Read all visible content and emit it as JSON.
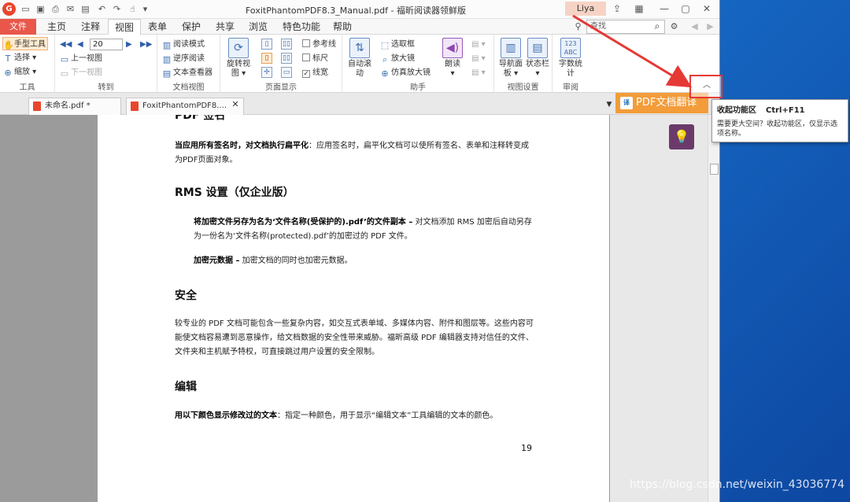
{
  "window": {
    "title": "FoxitPhantomPDF8.3_Manual.pdf - 福昕阅读器领鲜版",
    "user": "Liya"
  },
  "menu": {
    "file": "文件",
    "tabs": [
      "主页",
      "注释",
      "视图",
      "表单",
      "保护",
      "共享",
      "浏览",
      "特色功能",
      "帮助"
    ],
    "active": "视图",
    "search_placeholder": "查找"
  },
  "ribbon": {
    "tools": {
      "hand": "手型工具",
      "select": "选择",
      "zoom": "缩放",
      "label": "工具"
    },
    "goto": {
      "page_value": "20",
      "prev_view": "上一视图",
      "next_view": "下一视图",
      "label": "转到"
    },
    "doc_view": {
      "read_mode": "阅读模式",
      "reverse_read": "逆序阅读",
      "text_viewer": "文本查看器",
      "label": "文档视图"
    },
    "page_display": {
      "rotate": "旋转视图",
      "guides": "参考线",
      "ruler": "标尺",
      "linewidth": "线宽",
      "label": "页面显示"
    },
    "assistant": {
      "auto_scroll": "自动滚动",
      "marquee": "选取框",
      "loupe": "放大镜",
      "magnifier": "仿真放大镜",
      "read_aloud": "朗读",
      "label": "助手"
    },
    "view_settings": {
      "nav_panel": "导航面板",
      "status_bar": "状态栏",
      "label": "视图设置"
    },
    "review": {
      "word_count": "字数统计",
      "word_count_icon": "123 ABC",
      "label": "审阅"
    }
  },
  "tabs": [
    {
      "label": "未命名.pdf *"
    },
    {
      "label": "FoxitPhantomPDF8...."
    }
  ],
  "translate_button": "PDF文档翻译",
  "tooltip": {
    "title": "收起功能区",
    "shortcut": "Ctrl+F11",
    "desc": "需要更大空间？收起功能区，仅显示选项名称。"
  },
  "document": {
    "h_sign": "PDF 签名",
    "p_sign_bold": "当应用所有签名时，对文档执行扁平化",
    "p_sign_rest": "：应用签名时，扁平化文档可以使所有签名、表单和注释转变成为PDF页面对象。",
    "h_rms": "RMS 设置（仅企业版）",
    "p_rms1_bold": "将加密文件另存为名为‘文件名称(受保护的).pdf’的文件副本 –",
    "p_rms1_rest": " 对文档添加 RMS 加密后自动另存为一份名为‘文件名称(protected).pdf’的加密过的 PDF 文件。",
    "p_rms2_bold": "加密元数据 –",
    "p_rms2_rest": " 加密文档的同时也加密元数据。",
    "h_security": "安全",
    "p_security": "较专业的 PDF 文档可能包含一些复杂内容，如交互式表单域、多媒体内容、附件和图层等。这些内容可能使文档容易遭到恶意操作，给文档数据的安全性带来威胁。福昕高级 PDF 编辑器支持对信任的文件、文件夹和主机赋予特权，可直接跳过用户设置的安全限制。",
    "h_edit": "编辑",
    "p_edit_bold": "用以下颜色显示修改过的文本",
    "p_edit_rest": "：指定一种颜色，用于显示“编辑文本”工具编辑的文本的颜色。",
    "page_number": "19"
  },
  "watermark": "https://blog.csdn.net/weixin_43036774",
  "colors": {
    "accent": "#e8574a",
    "translate": "#f39c3a",
    "highlight_border": "#e53935"
  }
}
